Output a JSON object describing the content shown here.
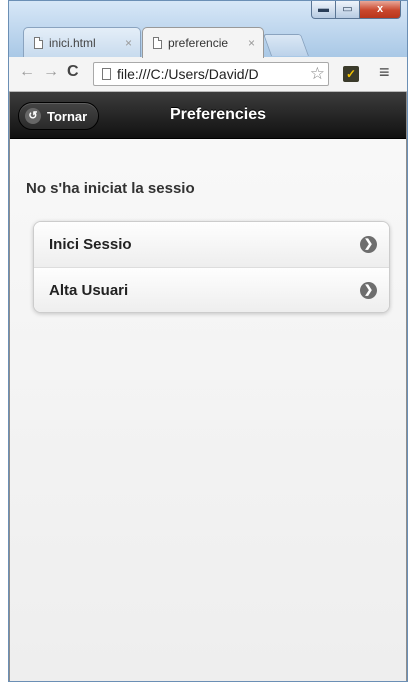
{
  "browser": {
    "tabs": [
      {
        "title": "inici.html",
        "close": "×",
        "icon": "document-icon",
        "active": false
      },
      {
        "title": "preferencie",
        "close": "×",
        "icon": "document-icon",
        "active": true
      }
    ],
    "window_controls": {
      "minimize": "▬",
      "maximize": "▭",
      "close": "x"
    },
    "toolbar": {
      "back": "←",
      "forward": "→",
      "reload": "C",
      "address": "file:///C:/Users/David/D",
      "bookmark": "☆",
      "extension": "✓",
      "menu": "≡"
    }
  },
  "page": {
    "header": {
      "back_label": "Tornar",
      "back_icon": "↺",
      "title": "Preferencies"
    },
    "status": "No s'ha iniciat la sessio",
    "list": [
      {
        "label": "Inici Sessio",
        "icon": "chevron-right-icon",
        "glyph": "❯"
      },
      {
        "label": "Alta Usuari",
        "icon": "chevron-right-icon",
        "glyph": "❯"
      }
    ]
  },
  "colors": {
    "header_bg": "#1e1e1e",
    "window_frame": "#bcd6ee",
    "page_bg": "#f4f4f4"
  }
}
